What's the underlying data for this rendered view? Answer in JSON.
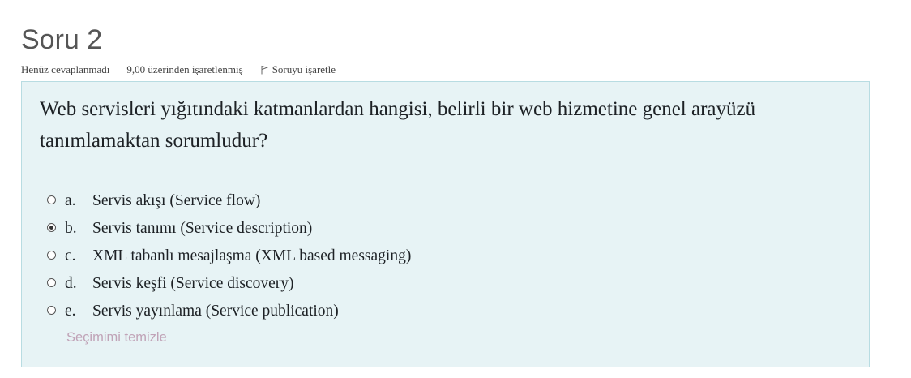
{
  "question": {
    "title": "Soru 2",
    "status": "Henüz cevaplanmadı",
    "grade": "9,00 üzerinden işaretlenmiş",
    "flag_label": "Soruyu işaretle",
    "text": "Web servisleri yığıtındaki katmanlardan hangisi, belirli bir web hizmetine genel arayüzü tanımlamaktan sorumludur?",
    "options": [
      {
        "letter": "a.",
        "label": "Servis akışı (Service flow)",
        "selected": false
      },
      {
        "letter": "b.",
        "label": "Servis tanımı (Service description)",
        "selected": true
      },
      {
        "letter": "c.",
        "label": "XML tabanlı mesajlaşma (XML based messaging)",
        "selected": false
      },
      {
        "letter": "d.",
        "label": "Servis keşfi (Service discovery)",
        "selected": false
      },
      {
        "letter": "e.",
        "label": "Servis yayınlama (Service publication)",
        "selected": false
      }
    ],
    "clear_label": "Seçimimi temizle"
  },
  "colors": {
    "panel_background": "#e7f3f5",
    "panel_border": "#b8dce2",
    "clear_link": "#c0a3b7",
    "title": "#555555"
  },
  "icons": {
    "flag": "flag-outline-icon",
    "radio": "radio-button-icon"
  }
}
